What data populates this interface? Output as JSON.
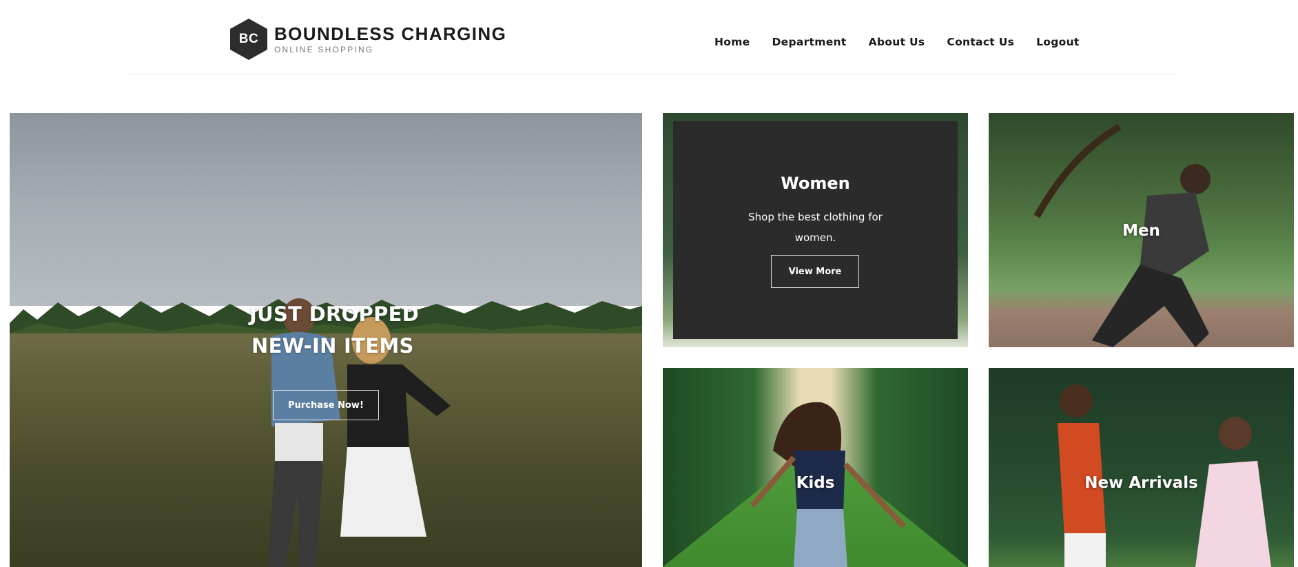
{
  "brand": {
    "monogram": "BC",
    "name": "BOUNDLESS CHARGING",
    "tagline": "ONLINE SHOPPING"
  },
  "nav": {
    "items": [
      "Home",
      "Department",
      "About Us",
      "Contact Us",
      "Logout"
    ]
  },
  "hero": {
    "line1": "JUST DROPPED",
    "line2": "NEW-IN ITEMS",
    "button": "Purchase Now!"
  },
  "women": {
    "title": "Women",
    "description": "Shop the best clothing for women.",
    "button": "View More"
  },
  "men": {
    "title": "Men"
  },
  "kids": {
    "title": "Kids"
  },
  "arrivals": {
    "title": "New Arrivals"
  },
  "colors": {
    "panel": "#2c2b2b",
    "text_on_image": "#ffffff",
    "logo_hex": "#2d2d2d"
  }
}
